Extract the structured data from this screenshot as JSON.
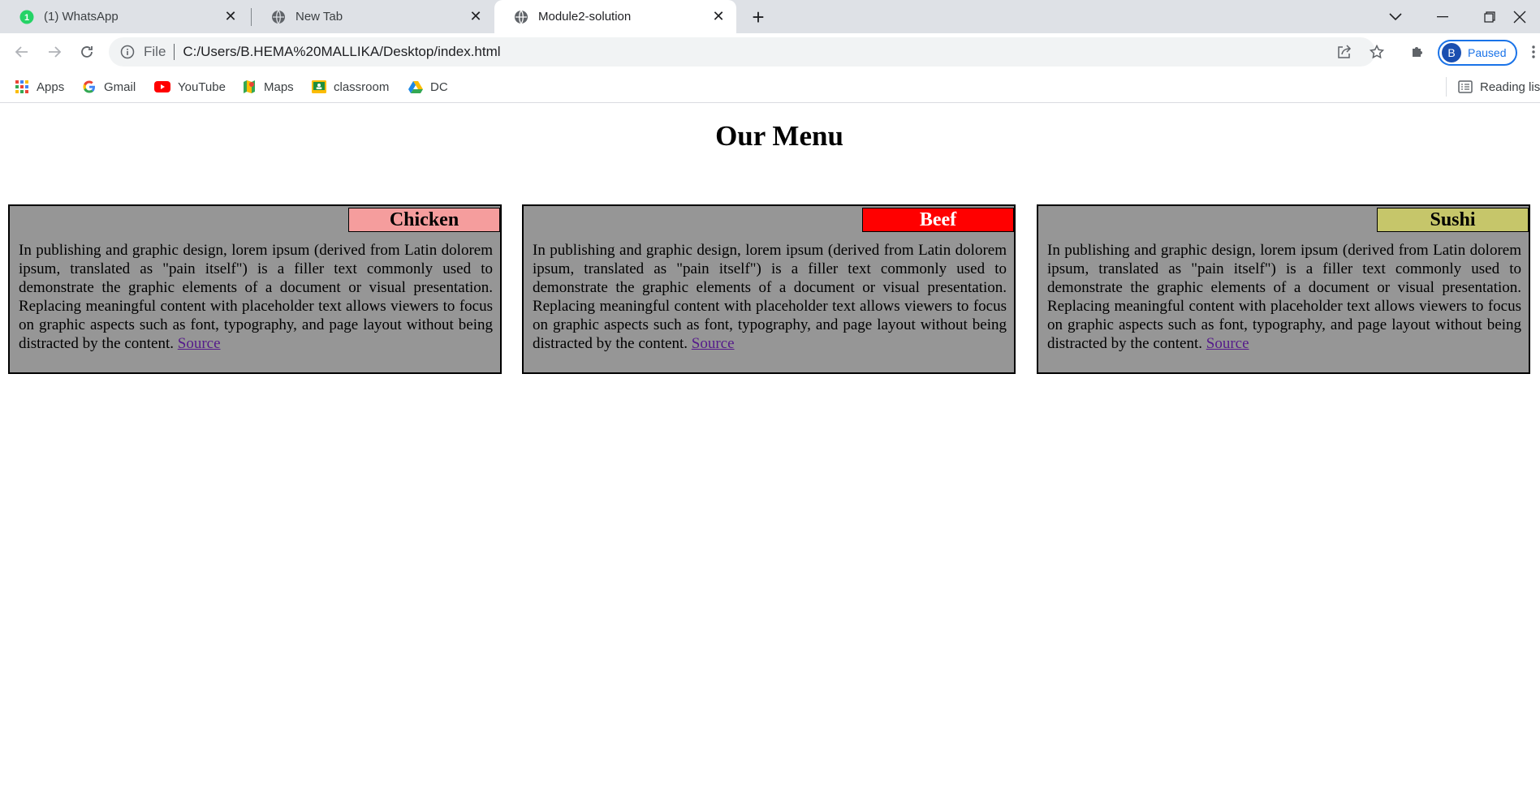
{
  "browser": {
    "tabs": [
      {
        "title": "(1) WhatsApp",
        "badge": "1",
        "active": false
      },
      {
        "title": "New Tab",
        "active": false
      },
      {
        "title": "Module2-solution",
        "active": true
      }
    ],
    "address": {
      "scheme_label": "File",
      "url": "C:/Users/B.HEMA%20MALLIKA/Desktop/index.html"
    },
    "profile": {
      "initial": "B",
      "status": "Paused"
    },
    "bookmarks": [
      {
        "label": "Apps",
        "icon": "apps-grid-icon"
      },
      {
        "label": "Gmail",
        "icon": "google-icon"
      },
      {
        "label": "YouTube",
        "icon": "youtube-icon"
      },
      {
        "label": "Maps",
        "icon": "maps-icon"
      },
      {
        "label": "classroom",
        "icon": "classroom-icon"
      },
      {
        "label": "DC",
        "icon": "drive-icon"
      }
    ],
    "reading_list": "Reading lis"
  },
  "page": {
    "title": "Our Menu",
    "cards": [
      {
        "label": "Chicken",
        "label_color": "#f59d9d",
        "text": "In publishing and graphic design, lorem ipsum (derived from Latin dolorem ipsum, translated as \"pain itself\") is a filler text commonly used to demonstrate the graphic elements of a document or visual presentation. Replacing meaningful content with placeholder text allows viewers to focus on graphic aspects such as font, typography, and page layout without being distracted by the content.",
        "link": "Source"
      },
      {
        "label": "Beef",
        "label_color": "#ff0000",
        "text": "In publishing and graphic design, lorem ipsum (derived from Latin dolorem ipsum, translated as \"pain itself\") is a filler text commonly used to demonstrate the graphic elements of a document or visual presentation. Replacing meaningful content with placeholder text allows viewers to focus on graphic aspects such as font, typography, and page layout without being distracted by the content.",
        "link": "Source"
      },
      {
        "label": "Sushi",
        "label_color": "#c6c66a",
        "text": "In publishing and graphic design, lorem ipsum (derived from Latin dolorem ipsum, translated as \"pain itself\") is a filler text commonly used to demonstrate the graphic elements of a document or visual presentation. Replacing meaningful content with placeholder text allows viewers to focus on graphic aspects such as font, typography, and page layout without being distracted by the content.",
        "link": "Source"
      }
    ]
  },
  "colors": {
    "card_bg": "#969696",
    "tabstrip_bg": "#dee1e6",
    "link": "#551a8b",
    "profile_accent": "#1a73e8"
  }
}
